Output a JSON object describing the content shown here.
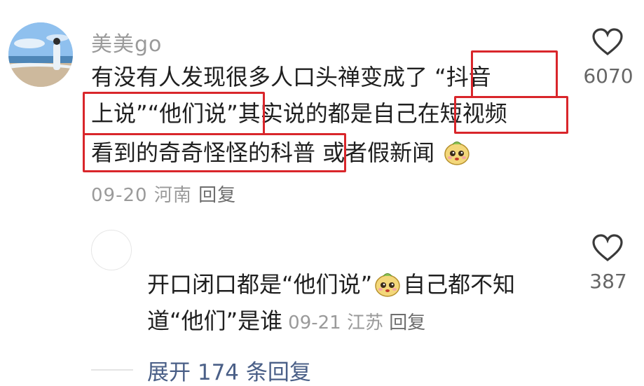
{
  "comment": {
    "username": "美美go",
    "line1": "有没有人发现很多人口头禅变成了 “抖音",
    "line2": "上说”“他们说”其实说的都是自己在短视频",
    "line3": "看到的奇奇怪怪的科普  或者假新闻",
    "date": "09-20",
    "location": "河南",
    "reply_label": "回复",
    "like_count": "6070",
    "emoji": "dog-emoji"
  },
  "reply": {
    "line1_a": "开口闭口都是“他们说”",
    "line1_b": "自己都不知",
    "line2": "道“他们”是谁",
    "date": "09-21",
    "location": "江苏",
    "reply_label": "回复",
    "like_count": "387",
    "emoji": "dog-emoji"
  },
  "expand": {
    "label": "展开 174 条回复"
  },
  "colors": {
    "highlight_box": "#d9262b",
    "link": "#4a5f87",
    "meta": "#9a9a9a"
  }
}
